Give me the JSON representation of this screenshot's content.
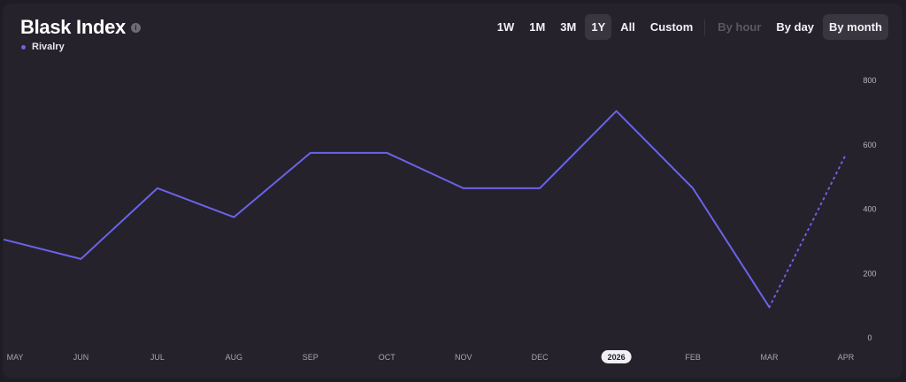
{
  "header": {
    "title": "Blask Index",
    "info_icon": "info-icon",
    "legend_label": "Rivalry"
  },
  "toolbar": {
    "ranges": [
      {
        "label": "1W",
        "active": false
      },
      {
        "label": "1M",
        "active": false
      },
      {
        "label": "3M",
        "active": false
      },
      {
        "label": "1Y",
        "active": true
      },
      {
        "label": "All",
        "active": false
      },
      {
        "label": "Custom",
        "active": false
      }
    ],
    "granularity": [
      {
        "label": "By hour",
        "active": false,
        "disabled": true
      },
      {
        "label": "By day",
        "active": false,
        "disabled": false
      },
      {
        "label": "By month",
        "active": true,
        "disabled": false
      }
    ]
  },
  "colors": {
    "series": "#6b63e8",
    "background": "#25222c",
    "active_button": "#393640"
  },
  "chart_data": {
    "type": "line",
    "categories": [
      "MAY",
      "JUN",
      "JUL",
      "AUG",
      "SEP",
      "OCT",
      "NOV",
      "DEC",
      "2026",
      "FEB",
      "MAR",
      "APR"
    ],
    "highlight_category": "2026",
    "series": [
      {
        "name": "Rivalry",
        "values": [
          305,
          245,
          465,
          375,
          575,
          575,
          465,
          465,
          705,
          465,
          95,
          570
        ],
        "projected_from_index": 10
      }
    ],
    "yticks": [
      0,
      200,
      400,
      600,
      800
    ],
    "ylim": [
      0,
      800
    ],
    "grid": false,
    "axis_side": "right"
  }
}
